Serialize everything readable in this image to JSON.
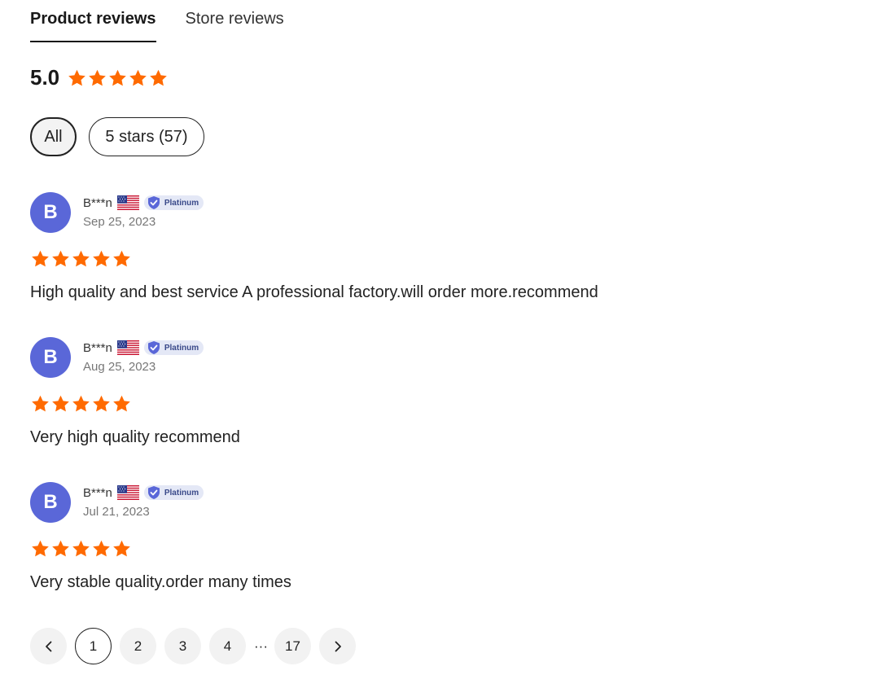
{
  "tabs": [
    {
      "label": "Product reviews",
      "active": true
    },
    {
      "label": "Store reviews",
      "active": false
    }
  ],
  "summary": {
    "score": "5.0",
    "stars": 5
  },
  "filters": [
    {
      "label": "All",
      "active": true
    },
    {
      "label": "5 stars (57)",
      "active": false
    }
  ],
  "reviews": [
    {
      "initial": "B",
      "name": "B***n",
      "country_icon": "us-flag-icon",
      "badge": "Platinum",
      "date": "Sep 25, 2023",
      "rating": 5,
      "text": "High quality and best service A professional factory.will order more.recommend"
    },
    {
      "initial": "B",
      "name": "B***n",
      "country_icon": "us-flag-icon",
      "badge": "Platinum",
      "date": "Aug 25, 2023",
      "rating": 5,
      "text": "Very high quality recommend"
    },
    {
      "initial": "B",
      "name": "B***n",
      "country_icon": "us-flag-icon",
      "badge": "Platinum",
      "date": "Jul 21, 2023",
      "rating": 5,
      "text": "Very stable quality.order many times"
    }
  ],
  "pagination": {
    "prev_icon": "chevron-left-icon",
    "pages": [
      "1",
      "2",
      "3",
      "4"
    ],
    "ellipsis": "···",
    "last": "17",
    "current": "1",
    "next_icon": "chevron-right-icon"
  },
  "colors": {
    "star": "#ff6a00",
    "avatar": "#5a67d8",
    "badge_bg": "#e4e8f6"
  }
}
